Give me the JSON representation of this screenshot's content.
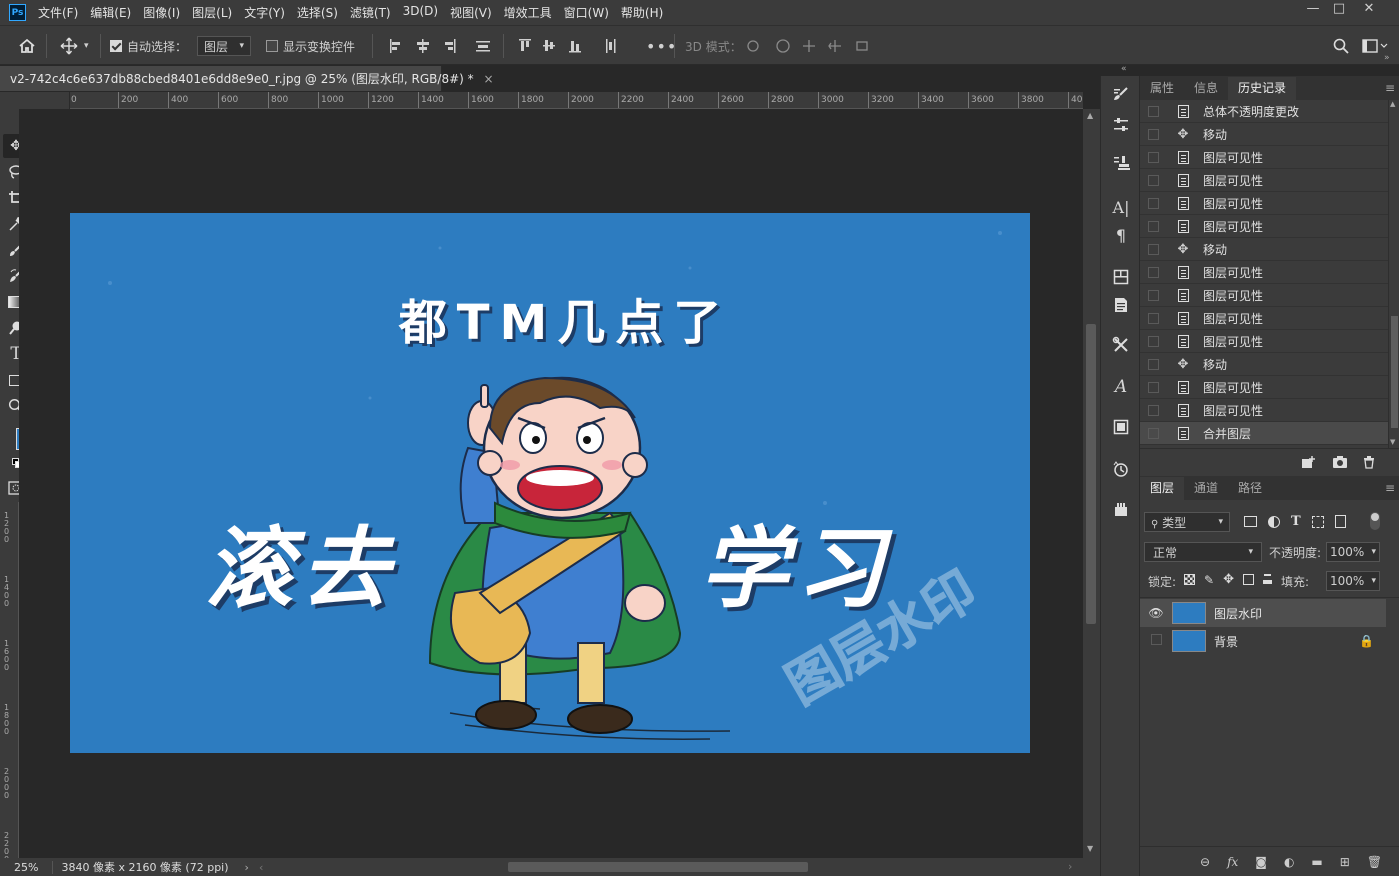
{
  "app": {
    "logo": "Ps"
  },
  "menu": [
    "文件(F)",
    "编辑(E)",
    "图像(I)",
    "图层(L)",
    "文字(Y)",
    "选择(S)",
    "滤镜(T)",
    "3D(D)",
    "视图(V)",
    "增效工具",
    "窗口(W)",
    "帮助(H)"
  ],
  "window_controls": {
    "minimize": "—",
    "maximize": "□",
    "close": "✕"
  },
  "options_bar": {
    "auto_select_label": "自动选择：",
    "auto_select_value": "图层",
    "show_transform_label": "显示变换控件",
    "mode_3d_label": "3D 模式："
  },
  "document": {
    "tab_title": "v2-742c4c6e637db88cbed8401e6dd8e9e0_r.jpg @ 25% (图层水印, RGB/8#) *",
    "zoom": "25%",
    "info": "3840 像素 x 2160 像素 (72 ppi)"
  },
  "ruler": {
    "h_ticks": [
      "200",
      "0",
      "200",
      "400",
      "600",
      "800",
      "1000",
      "1200",
      "1400",
      "1600",
      "1800",
      "2000",
      "2200",
      "2400",
      "2600",
      "2800",
      "3000",
      "3200",
      "3400",
      "3600",
      "3800",
      "40"
    ],
    "v_ticks": [
      "1200",
      "1400",
      "1600",
      "1800",
      "2000",
      "2200"
    ]
  },
  "artwork": {
    "headline": "都TM几点了",
    "left_text": "滚去",
    "right_text": "学习",
    "watermark": "图层水印"
  },
  "colors": {
    "foreground": "#2d7cc0",
    "background": "#000000",
    "canvas_bg": "#2d7cc0"
  },
  "history_panel": {
    "tabs": [
      "属性",
      "信息",
      "历史记录"
    ],
    "active_tab": "历史记录",
    "items": [
      {
        "icon": "doc",
        "label": "总体不透明度更改"
      },
      {
        "icon": "move",
        "label": "移动"
      },
      {
        "icon": "doc",
        "label": "图层可见性"
      },
      {
        "icon": "doc",
        "label": "图层可见性"
      },
      {
        "icon": "doc",
        "label": "图层可见性"
      },
      {
        "icon": "doc",
        "label": "图层可见性"
      },
      {
        "icon": "move",
        "label": "移动"
      },
      {
        "icon": "doc",
        "label": "图层可见性"
      },
      {
        "icon": "doc",
        "label": "图层可见性"
      },
      {
        "icon": "doc",
        "label": "图层可见性"
      },
      {
        "icon": "doc",
        "label": "图层可见性"
      },
      {
        "icon": "move",
        "label": "移动"
      },
      {
        "icon": "doc",
        "label": "图层可见性"
      },
      {
        "icon": "doc",
        "label": "图层可见性"
      },
      {
        "icon": "doc",
        "label": "合并图层"
      }
    ]
  },
  "layers_panel": {
    "tabs": [
      "图层",
      "通道",
      "路径"
    ],
    "active_tab": "图层",
    "filter_label": "类型",
    "blend_mode": "正常",
    "opacity_label": "不透明度:",
    "opacity_value": "100%",
    "lock_label": "锁定:",
    "fill_label": "填充:",
    "fill_value": "100%",
    "layers": [
      {
        "name": "图层水印",
        "visible": true,
        "selected": true,
        "locked": false
      },
      {
        "name": "背景",
        "visible": false,
        "selected": false,
        "locked": true
      }
    ]
  }
}
